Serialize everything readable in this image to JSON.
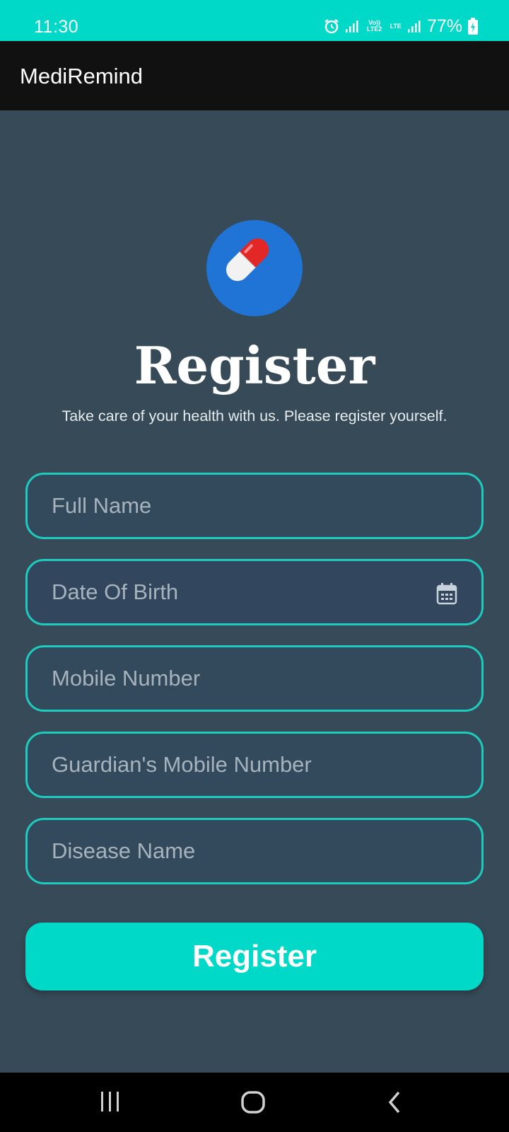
{
  "status_bar": {
    "time": "11:30",
    "network_1": "Vo)) LTE2",
    "network_2": "LTE",
    "battery": "77%"
  },
  "app_bar": {
    "title": "MediRemind"
  },
  "register": {
    "logo_icon": "pill-capsule-icon",
    "title": "Register",
    "subtitle": "Take care of your health with us. Please register yourself."
  },
  "form": {
    "full_name_placeholder": "Full Name",
    "dob_placeholder": "Date Of Birth",
    "mobile_placeholder": "Mobile Number",
    "guardian_mobile_placeholder": "Guardian's Mobile Number",
    "disease_placeholder": "Disease Name",
    "submit_label": "Register"
  },
  "nav_bar": {
    "recents_icon": "recents-icon",
    "home_icon": "home-icon",
    "back_icon": "back-icon"
  },
  "colors": {
    "accent": "#00d9c8",
    "background": "#364a57",
    "app_bar": "#111111",
    "field_border": "#1ecbbf",
    "logo_circle": "#2074d6"
  }
}
